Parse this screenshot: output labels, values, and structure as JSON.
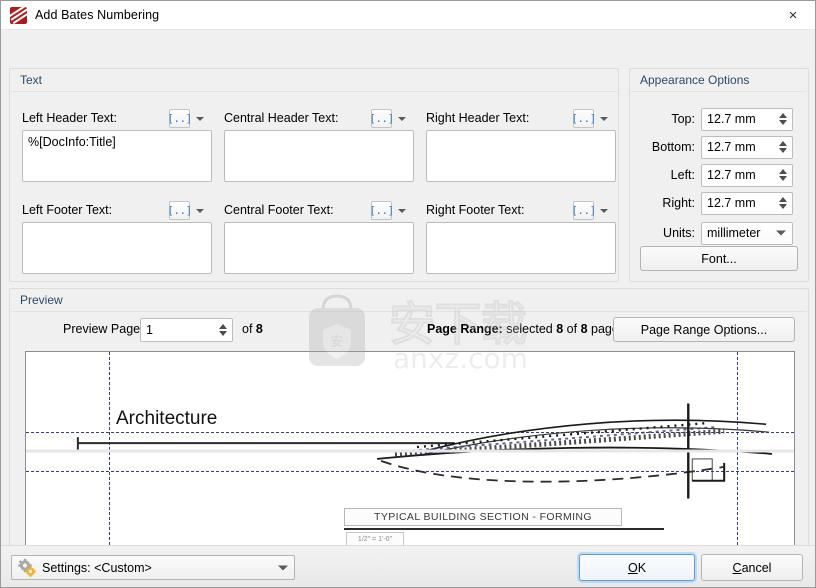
{
  "window": {
    "title": "Add Bates Numbering",
    "app_icon": "bates-stamp-icon",
    "close_icon": "×"
  },
  "groups": {
    "text": {
      "title": "Text"
    },
    "appearance": {
      "title": "Appearance Options"
    },
    "preview": {
      "title": "Preview"
    }
  },
  "text_fields": [
    {
      "label": "Left Header Text:",
      "value": "%[DocInfo:Title]",
      "macro_icon": "[..]"
    },
    {
      "label": "Central Header Text:",
      "value": "",
      "macro_icon": "[..]"
    },
    {
      "label": "Right Header Text:",
      "value": "",
      "macro_icon": "[..]"
    },
    {
      "label": "Left Footer Text:",
      "value": "",
      "macro_icon": "[..]"
    },
    {
      "label": "Central Footer Text:",
      "value": "",
      "macro_icon": "[..]"
    },
    {
      "label": "Right Footer Text:",
      "value": "",
      "macro_icon": "[..]"
    }
  ],
  "appearance": {
    "margins": [
      {
        "label": "Top:",
        "value": "12.7 mm"
      },
      {
        "label": "Bottom:",
        "value": "12.7 mm"
      },
      {
        "label": "Left:",
        "value": "12.7 mm"
      },
      {
        "label": "Right:",
        "value": "12.7 mm"
      }
    ],
    "units": {
      "label": "Units:",
      "value": "millimeter"
    },
    "font_button": "Font..."
  },
  "preview": {
    "page_label": "Preview Page",
    "page_value": "1",
    "of_prefix": "of ",
    "total_pages": "8",
    "page_range_prefix": "Page Range:",
    "page_range_mid": " selected ",
    "page_range_selected": "8",
    "page_range_of": " of ",
    "page_range_total": "8",
    "page_range_suffix": " pages",
    "page_range_options_button": "Page Range Options...",
    "document": {
      "heading": "Architecture",
      "title_block": "TYPICAL BUILDING SECTION - FORMING",
      "scale_block": "1/2\" = 1'-0\""
    }
  },
  "watermark": {
    "site": "anxz.com",
    "logo_text": "安下载"
  },
  "footer": {
    "settings_label": "Settings:  <Custom>",
    "settings_icon": "gear-icon",
    "ok_accel": "O",
    "ok_rest": "K",
    "cancel_accel": "C",
    "cancel_rest": "ancel"
  },
  "colors": {
    "accent": "#2a4a66",
    "focus": "#5c9dd4",
    "icon_red": "#b11a1a",
    "guide": "#1f2d6e"
  }
}
